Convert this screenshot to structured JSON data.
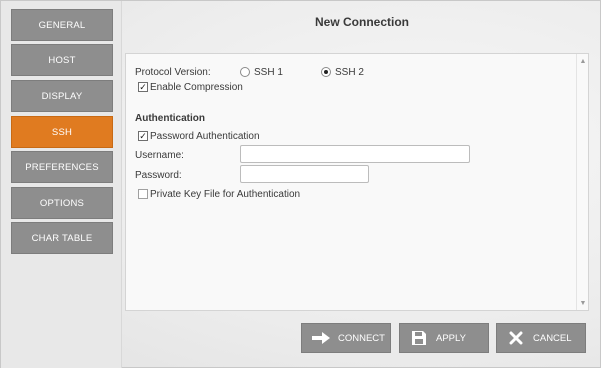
{
  "dialog": {
    "title": "New Connection"
  },
  "sidebar": {
    "items": [
      {
        "label": "GENERAL",
        "active": false
      },
      {
        "label": "HOST",
        "active": false
      },
      {
        "label": "DISPLAY",
        "active": false
      },
      {
        "label": "SSH",
        "active": true
      },
      {
        "label": "PREFERENCES",
        "active": false
      },
      {
        "label": "OPTIONS",
        "active": false
      },
      {
        "label": "CHAR TABLE",
        "active": false
      }
    ]
  },
  "ssh": {
    "protocol_label": "Protocol Version:",
    "ssh1_label": "SSH 1",
    "ssh1_selected": false,
    "ssh2_label": "SSH 2",
    "ssh2_selected": true,
    "compression_label": "Enable Compression",
    "compression_checked": true,
    "auth_title": "Authentication",
    "password_auth_label": "Password Authentication",
    "password_auth_checked": true,
    "username_label": "Username:",
    "username_value": "",
    "password_label": "Password:",
    "password_value": "",
    "private_key_label": "Private Key File for Authentication",
    "private_key_checked": false
  },
  "actions": {
    "connect_label": "CONNECT",
    "apply_label": "APPLY",
    "cancel_label": "CANCEL"
  },
  "colors": {
    "accent": "#e07b20",
    "button_gray": "#8e8e8e"
  }
}
